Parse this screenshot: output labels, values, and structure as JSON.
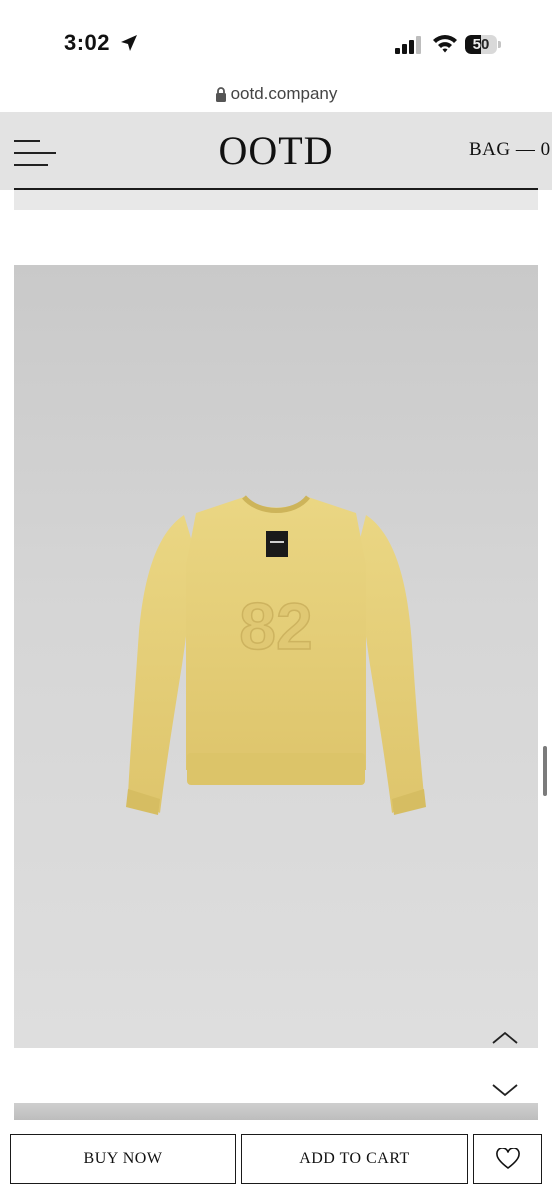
{
  "status_bar": {
    "time": "3:02",
    "battery_level": "50",
    "battery_fraction": 0.5,
    "icons": [
      "location-arrow-icon",
      "cellular-signal-icon",
      "wifi-icon",
      "battery-icon"
    ]
  },
  "browser": {
    "url": "ootd.company",
    "icons": [
      "lock-icon"
    ]
  },
  "header": {
    "logo": "OOTD",
    "bag_label": "BAG — 0",
    "icons": [
      "hamburger-menu-icon"
    ]
  },
  "product": {
    "image_subject": "yellow knit sweater",
    "icons": [
      "chevron-up-icon",
      "chevron-down-icon"
    ]
  },
  "actions": {
    "buy_now": "BUY NOW",
    "add_to_cart": "ADD TO CART",
    "icons": [
      "heart-icon"
    ]
  },
  "colors": {
    "header_bg": "#e3e3e3",
    "image_bg": "#d3d3d3",
    "sweater": "#e6cf7a",
    "text": "#111111"
  }
}
